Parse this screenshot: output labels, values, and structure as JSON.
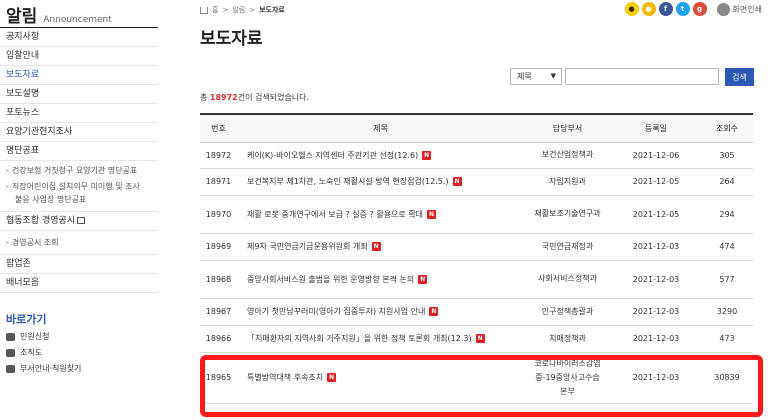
{
  "sidebar": {
    "title": "알림",
    "subtitle": "Announcement",
    "items": [
      {
        "label": "공지사항"
      },
      {
        "label": "입찰안내"
      },
      {
        "label": "보도자료"
      },
      {
        "label": "보도설명"
      },
      {
        "label": "포토뉴스"
      },
      {
        "label": "요양기관현지조사"
      },
      {
        "label": "명단공표"
      }
    ],
    "subitems": [
      {
        "label": "건강보험 거짓청구 요양기관 명단공표"
      },
      {
        "label": "직장어린이집 설치의무 미이행 및 조사"
      },
      {
        "label": "불응 사업장 명단공표"
      }
    ],
    "items2": [
      {
        "label": "협동조합 경영공시"
      }
    ],
    "subitems2": [
      {
        "label": "경영공시 조회"
      }
    ],
    "items3": [
      {
        "label": "팝업존"
      },
      {
        "label": "배너모음"
      }
    ],
    "quick": {
      "title": "바로가기",
      "items": [
        {
          "label": "민원신청"
        },
        {
          "label": "조직도"
        },
        {
          "label": "부서안내·직원찾기"
        }
      ]
    }
  },
  "breadcrumb": {
    "home": "홈",
    "level1": "알림",
    "current": "보도자료"
  },
  "social": {
    "print_label": "화면인쇄"
  },
  "page": {
    "title": "보도자료"
  },
  "search": {
    "select_value": "제목",
    "input_value": "",
    "button_label": "검색"
  },
  "result": {
    "prefix": "총 ",
    "count": "18972",
    "suffix": "건이 검색되었습니다."
  },
  "table": {
    "headers": [
      "번호",
      "제목",
      "담당부서",
      "등록일",
      "조회수"
    ],
    "new_badge": "N",
    "rows": [
      {
        "no": "18972",
        "title": "케이(K)-바이오헬스 지역센터 주관기관 선정(12.6)",
        "dept": "보건산업정책과",
        "date": "2021-12-06",
        "views": "305"
      },
      {
        "no": "18971",
        "title": "보건복지부 제1차관, 노숙인 재활시설 방역 현장점검(12.5.)",
        "dept": "자립지원과",
        "date": "2021-12-05",
        "views": "264"
      },
      {
        "no": "18970",
        "title": "재활 로봇 중개연구에서 보급 ? 실증 ? 활용으로 확대",
        "dept": "재활보조기술연구과",
        "date": "2021-12-05",
        "views": "294"
      },
      {
        "no": "18969",
        "title": "제9차 국민연금기금운용위원회 개최",
        "dept": "국민연금재정과",
        "date": "2021-12-03",
        "views": "474"
      },
      {
        "no": "18968",
        "title": "중앙사회서비스원 출범을 위한 운영방향 본격 논의",
        "dept": "사회서비스정책과",
        "date": "2021-12-03",
        "views": "577"
      },
      {
        "no": "18967",
        "title": "영아기 첫만남꾸러미(영아기 집중투자) 지원사업 안내",
        "dept": "인구정책총괄과",
        "date": "2021-12-03",
        "views": "3290"
      },
      {
        "no": "18966",
        "title": "「치매환자의 지역사회 거주지원」을 위한 정책 토론회 개최(12.3)",
        "dept": "치매정책과",
        "date": "2021-12-03",
        "views": "473"
      },
      {
        "no": "18965",
        "title": "특별방역대책 후속조치",
        "dept": "코로나바이러스감염증-19중앙사고수습본부",
        "date": "2021-12-03",
        "views": "30839"
      }
    ]
  },
  "colors": {
    "accent": "#2b59b5",
    "highlight": "#ff1a1a",
    "badge": "#e02020"
  }
}
